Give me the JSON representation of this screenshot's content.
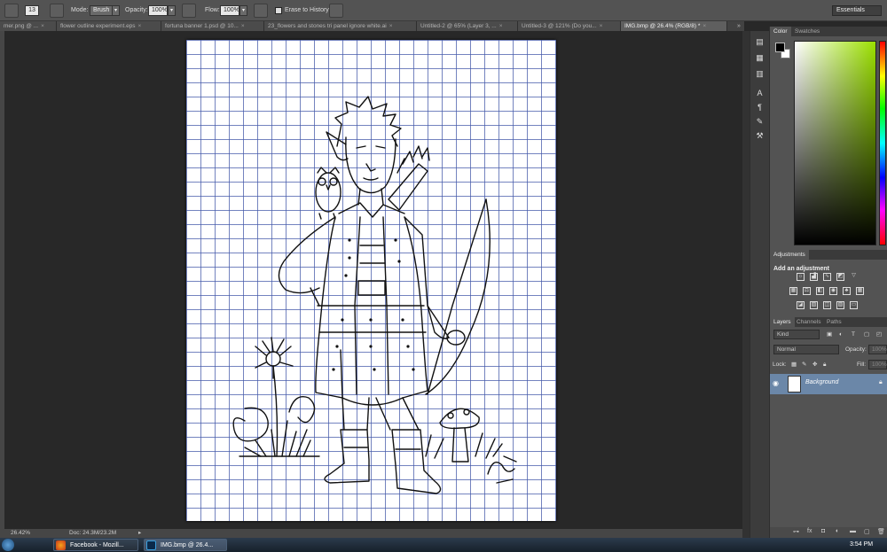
{
  "options_bar": {
    "brush_size": "13",
    "mode_label": "Mode:",
    "mode_value": "Brush",
    "opacity_label": "Opacity:",
    "opacity_value": "100%",
    "flow_label": "Flow:",
    "flow_value": "100%",
    "erase_to_history": "Erase to History",
    "erase_to_history_checked": false,
    "workspace": "Essentials"
  },
  "tabs": [
    {
      "label": "mer.png @ ...",
      "active": false
    },
    {
      "label": "flower outline experiment.eps",
      "active": false
    },
    {
      "label": "fortuna banner 1.psd @ 10...",
      "active": false
    },
    {
      "label": "23_flowers and stones tri panel ignore white.ai",
      "active": false
    },
    {
      "label": "Untitled-2 @ 65% (Layer 3, ...",
      "active": false
    },
    {
      "label": "Untitled-3 @ 121% (Do you...",
      "active": false
    },
    {
      "label": "IMG.bmp @ 26.4% (RGB/8) *",
      "active": true
    }
  ],
  "tab_overflow": "»",
  "status": {
    "zoom": "26.42%",
    "doc": "Doc: 24.3M/23.2M"
  },
  "color_panel": {
    "tabs": [
      "Color",
      "Swatches"
    ],
    "foreground": "#000000",
    "background": "#ffffff"
  },
  "adjustments_panel": {
    "tab": "Adjustments",
    "title": "Add an adjustment"
  },
  "layers_panel": {
    "tabs": [
      "Layers",
      "Channels",
      "Paths"
    ],
    "filter_kind": "Kind",
    "blend_mode": "Normal",
    "opacity_label": "Opacity:",
    "opacity_value": "100%",
    "lock_label": "Lock:",
    "fill_label": "Fill:",
    "fill_value": "100%",
    "layers": [
      {
        "name": "Background",
        "selected": true,
        "locked": true
      }
    ]
  },
  "taskbar": {
    "items": [
      {
        "label": "Facebook - Mozill...",
        "icon": "firefox-icon",
        "active": false
      },
      {
        "label": "IMG.bmp @ 26.4...",
        "icon": "photoshop-icon",
        "active": true
      }
    ],
    "clock": "3:54 PM"
  },
  "colors": {
    "chrome": "#535353",
    "pasteboard": "#282828",
    "grid_line": "#465aaa",
    "selected_layer": "#6b87a8"
  }
}
